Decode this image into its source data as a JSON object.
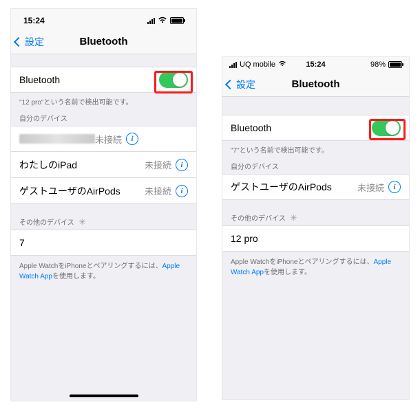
{
  "left": {
    "time": "15:24",
    "nav_back": "設定",
    "nav_title": "Bluetooth",
    "bt_label": "Bluetooth",
    "discover_caption": "\"12 pro\"という名前で検出可能です。",
    "my_devices_caption": "自分のデバイス",
    "devices": [
      {
        "name_hidden": true,
        "status": "未接続"
      },
      {
        "name": "わたしのiPad",
        "status": "未接続"
      },
      {
        "name": "ゲストユーザのAirPods",
        "status": "未接続"
      }
    ],
    "other_caption": "その他のデバイス",
    "other": [
      {
        "name": "7"
      }
    ],
    "footer_pre": "Apple WatchをiPhoneとペアリングするには、",
    "footer_link": "Apple Watch App",
    "footer_post": "を使用します。"
  },
  "right": {
    "carrier": "UQ mobile",
    "time": "15:24",
    "battery_pct": "98%",
    "nav_back": "設定",
    "nav_title": "Bluetooth",
    "bt_label": "Bluetooth",
    "discover_caption": "\"7\"という名前で検出可能です。",
    "my_devices_caption": "自分のデバイス",
    "devices": [
      {
        "name": "ゲストユーザのAirPods",
        "status": "未接続"
      }
    ],
    "other_caption": "その他のデバイス",
    "other": [
      {
        "name": "12 pro"
      }
    ],
    "footer_pre": "Apple WatchをiPhoneとペアリングするには、",
    "footer_link": "Apple Watch App",
    "footer_post": "を使用します。"
  }
}
